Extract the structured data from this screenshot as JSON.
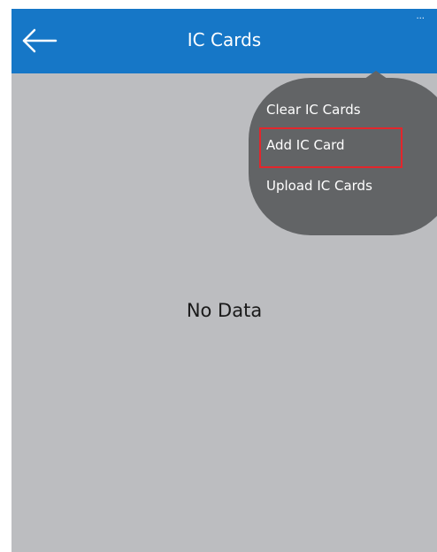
{
  "header": {
    "title": "IC Cards",
    "back_icon": "arrow-left-icon",
    "more_label": "..."
  },
  "menu": {
    "items": [
      {
        "label": "Clear IC Cards"
      },
      {
        "label": "Add IC Card"
      },
      {
        "label": "Upload IC Cards"
      }
    ]
  },
  "content": {
    "empty_text": "No Data"
  },
  "colors": {
    "header_bg": "#1677c7",
    "screen_bg": "#bcbdc0",
    "popup_bg": "#626466",
    "highlight": "#e3262c"
  }
}
